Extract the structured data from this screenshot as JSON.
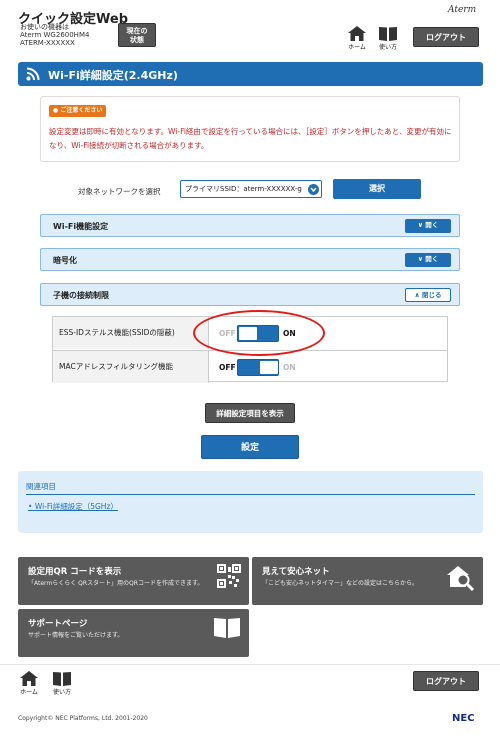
{
  "header": {
    "app_title": "クイック設定Web",
    "device_caption": "お使いの機器は",
    "device_model": "Aterm WG2600HM4",
    "device_name": "ATERM-XXXXXX",
    "status_button_line1": "現在の",
    "status_button_line2": "状態",
    "brand_logo": "Aterm",
    "home_label": "ホーム",
    "manual_label": "使い方",
    "logout_label": "ログアウト"
  },
  "page": {
    "title": "Wi-Fi詳細設定(2.4GHz)"
  },
  "notice": {
    "badge": "ご注意ください",
    "text": "設定変更は即時に有効となります。Wi-Fi経由で設定を行っている場合には、［設定］ボタンを押したあと、変更が有効になり、Wi-Fi接続が切断される場合があります。"
  },
  "network_select": {
    "label": "対象ネットワークを選択",
    "value": "プライマリSSID：aterm-XXXXXX-g",
    "button": "選択"
  },
  "sections": [
    {
      "title": "Wi-Fi機能設定",
      "button": "開く",
      "state": "collapsed"
    },
    {
      "title": "暗号化",
      "button": "開く",
      "state": "collapsed"
    },
    {
      "title": "子機の接続制限",
      "button": "閉じる",
      "state": "expanded"
    }
  ],
  "settings": [
    {
      "label": "ESS-IDステルス機能(SSIDの隠蔽)",
      "off_label": "OFF",
      "on_label": "ON",
      "value": "ON"
    },
    {
      "label": "MACアドレスフィルタリング機能",
      "off_label": "OFF",
      "on_label": "ON",
      "value": "OFF"
    }
  ],
  "actions": {
    "detail_button": "詳細設定項目を表示",
    "apply_button": "設定"
  },
  "related": {
    "title": "関連項目",
    "links": [
      "Wi-Fi詳細設定（5GHz）"
    ]
  },
  "tiles": [
    {
      "title": "設定用QR コードを表示",
      "desc": "「Atermらくらく QRスタート」用のQRコードを作成できます。",
      "icon": "qr-code-icon"
    },
    {
      "title": "見えて安心ネット",
      "desc": "「こども安心ネットタイマー」などの設定はこちらから。",
      "icon": "house-search-icon"
    },
    {
      "title": "サポートページ",
      "desc": "サポート情報をご覧いただけます。",
      "icon": "book-icon"
    }
  ],
  "footer": {
    "home_label": "ホーム",
    "manual_label": "使い方",
    "logout_label": "ログアウト",
    "copyright": "Copyright© NEC Platforms, Ltd. 2001-2020",
    "company_logo": "NEC"
  },
  "colors": {
    "primary": "#1f6eb4",
    "accordion_bg": "#ddeefa",
    "notice_text": "#c0282a",
    "notice_badge": "#e8751a",
    "dark_button": "#555555",
    "highlight": "#e31b1b"
  }
}
